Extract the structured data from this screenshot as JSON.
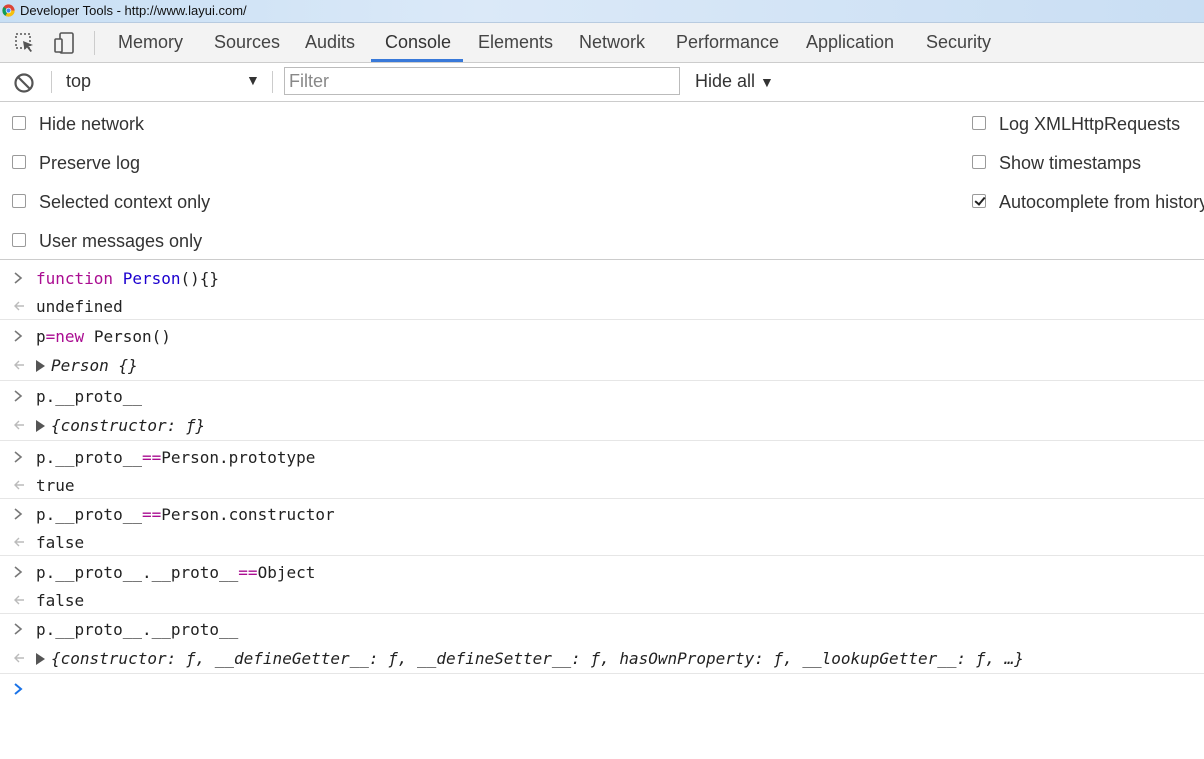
{
  "window": {
    "title": "Developer Tools - http://www.layui.com/"
  },
  "tabs": [
    {
      "label": "Memory"
    },
    {
      "label": "Sources"
    },
    {
      "label": "Audits"
    },
    {
      "label": "Console"
    },
    {
      "label": "Elements"
    },
    {
      "label": "Network"
    },
    {
      "label": "Performance"
    },
    {
      "label": "Application"
    },
    {
      "label": "Security"
    }
  ],
  "active_tab": "Console",
  "toolbar": {
    "context": "top",
    "filter_placeholder": "Filter",
    "levels": "Hide all"
  },
  "settings": {
    "left": [
      {
        "label": "Hide network",
        "checked": false
      },
      {
        "label": "Preserve log",
        "checked": false
      },
      {
        "label": "Selected context only",
        "checked": false
      },
      {
        "label": "User messages only",
        "checked": false
      }
    ],
    "right": [
      {
        "label": "Log XMLHttpRequests",
        "checked": false
      },
      {
        "label": "Show timestamps",
        "checked": false
      },
      {
        "label": "Autocomplete from history",
        "checked": true
      }
    ]
  },
  "console": {
    "entries": [
      {
        "input_parts": [
          "function",
          " ",
          "Person",
          "(){}"
        ],
        "output": "undefined"
      },
      {
        "input_parts": [
          "p",
          "=",
          "new",
          " Person()"
        ],
        "output": "Person {}"
      },
      {
        "input": "p.__proto__",
        "output": "{constructor: ƒ}"
      },
      {
        "input_parts": [
          "p.__proto__",
          "==",
          "Person.prototype"
        ],
        "output": "true"
      },
      {
        "input_parts": [
          "p.__proto__",
          "==",
          "Person.constructor"
        ],
        "output": "false"
      },
      {
        "input_parts": [
          "p.__proto__.__proto__",
          "==",
          "Object"
        ],
        "output": "false"
      },
      {
        "input": "p.__proto__.__proto__",
        "output": "{constructor: ƒ, __defineGetter__: ƒ, __defineSetter__: ƒ, hasOwnProperty: ƒ, __lookupGetter__: ƒ, …}"
      }
    ]
  },
  "colors": {
    "accent": "#3879d9",
    "keyword": "#aa0d91",
    "boolean": "#1c00cf",
    "prompt": "#1a73e8"
  },
  "icons": [
    "chrome-icon",
    "inspect-element-icon",
    "device-toolbar-icon",
    "clear-console-icon",
    "prompt-chevron-icon",
    "result-arrow-icon",
    "expand-triangle-icon"
  ]
}
